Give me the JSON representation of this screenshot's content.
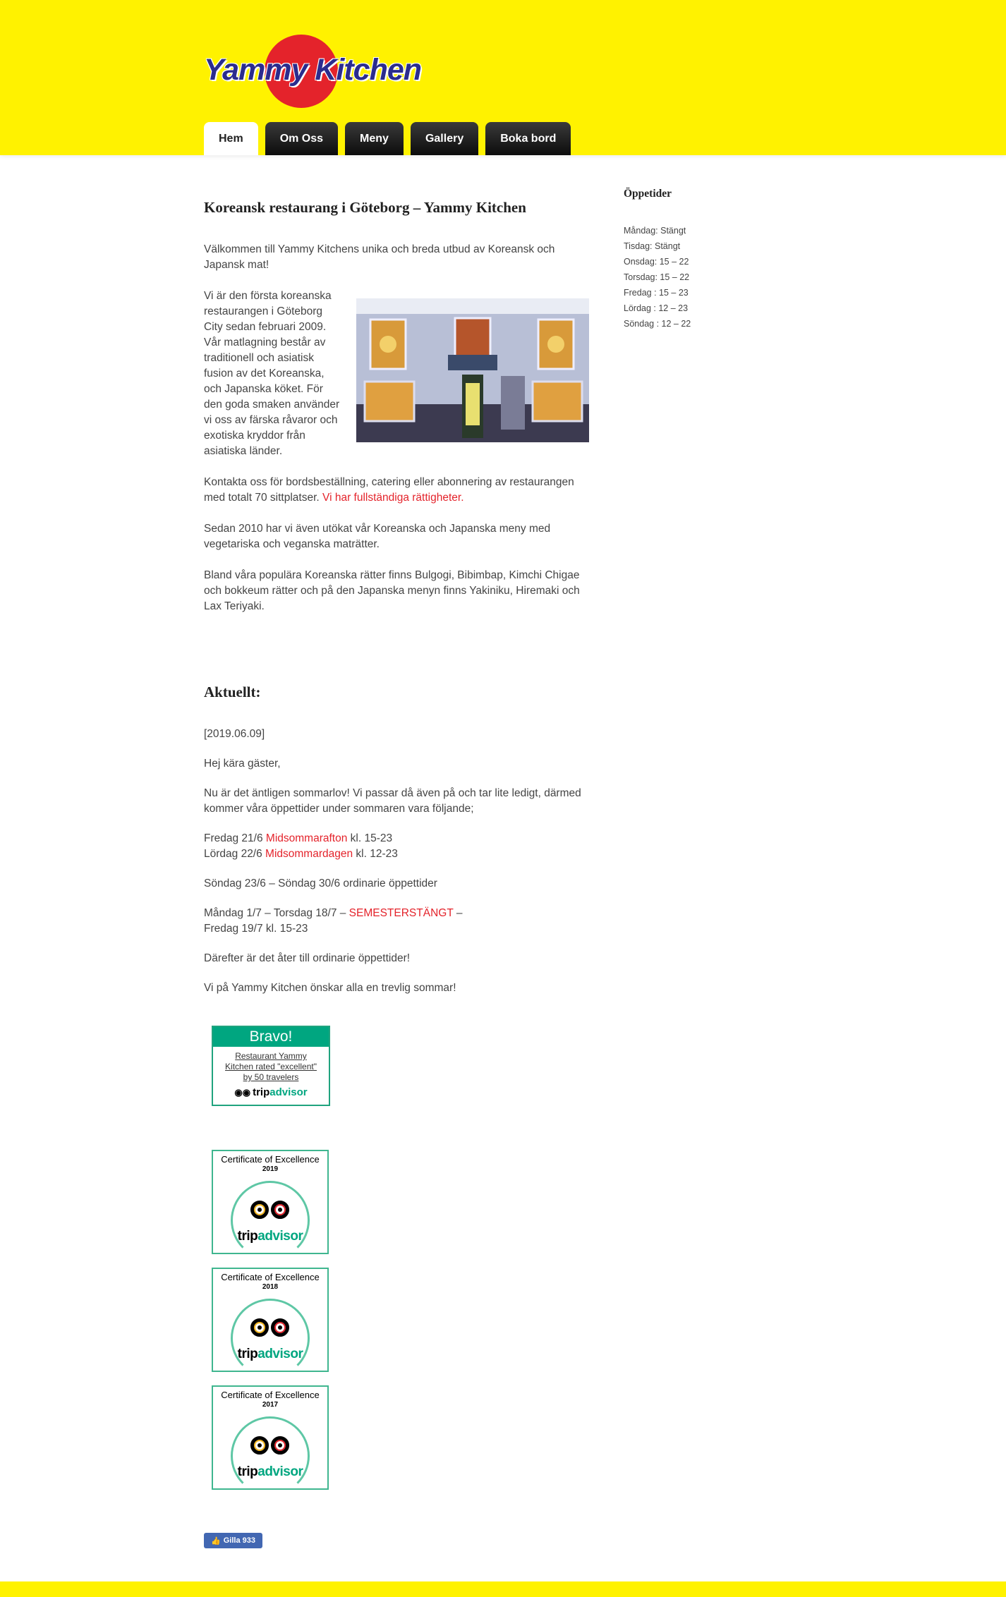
{
  "brand": {
    "name": "Yammy Kitchen",
    "color_primary": "#fff200",
    "color_accent": "#e4232b",
    "logo_text_color": "#2b2c8e"
  },
  "nav": [
    {
      "label": "Hem",
      "active": true
    },
    {
      "label": "Om Oss",
      "active": false
    },
    {
      "label": "Meny",
      "active": false
    },
    {
      "label": "Gallery",
      "active": false
    },
    {
      "label": "Boka bord",
      "active": false
    }
  ],
  "main": {
    "title": "Koreansk restaurang i Göteborg – Yammy Kitchen",
    "intro": "Välkommen till Yammy Kitchens unika och breda utbud av Koreansk och Japansk mat!",
    "about": "Vi är den första koreanska restaurangen i Göteborg City sedan februari 2009. Vår matlagning består av traditionell och asiatisk fusion av det Koreanska, och Japanska köket. För den goda smaken använder vi oss av färska råvaror och exotiska kryddor från asiatiska länder.",
    "contact": "Kontakta oss för bordsbeställning, catering eller abonnering av restaurangen med totalt 70 sittplatser.",
    "contact_link": "Vi har fullständiga rättigheter.",
    "vegan": "Sedan 2010 har vi även utökat vår Koreanska och Japanska meny med vegetariska och veganska maträtter.",
    "popular": "Bland våra populära Koreanska rätter finns Bulgogi, Bibimbap, Kimchi Chigae och bokkeum rätter och på den Japanska menyn finns Yakiniku, Hiremaki och Lax Teriyaki."
  },
  "news": {
    "heading": "Aktuellt:",
    "date": "[2019.06.09]",
    "greeting": "Hej kära gäster,",
    "summer": "Nu är det äntligen sommarlov! Vi passar då även på och tar lite ledigt, därmed kommer våra öppettider under sommaren vara följande;",
    "fri_prefix": "Fredag 21/6 ",
    "fri_link": "Midsommarafton",
    "fri_suffix": " kl. 15-23",
    "sat_prefix": "Lördag 22/6 ",
    "sat_link": "Midsommardagen",
    "sat_suffix": " kl. 12-23",
    "sun_line": "Söndag 23/6 – Söndag 30/6 ordinarie öppettider",
    "closed_prefix": "Måndag 1/7 – Torsdag 18/7 – ",
    "closed_link": "SEMESTERSTÄNGT",
    "closed_suffix": " –",
    "reopen": "Fredag 19/7 kl. 15-23",
    "after": "Därefter är det åter till ordinarie öppettider!",
    "wish": "Vi på Yammy Kitchen önskar alla en trevlig sommar!"
  },
  "sidebar": {
    "heading": "Öppetider",
    "hours": [
      "Måndag: Stängt",
      "Tisdag: Stängt",
      "Onsdag: 15 – 22",
      "Torsdag: 15 – 22",
      "Fredag : 15 – 23",
      "Lördag : 12 – 23",
      "Söndag : 12 – 22"
    ]
  },
  "tripadvisor": {
    "bravo_heading": "Bravo!",
    "bravo_text": "Restaurant Yammy Kitchen rated \"excellent\" by 50 travelers",
    "brand_prefix": "trip",
    "brand_suffix": "advisor",
    "certificates": [
      {
        "title": "Certificate of Excellence",
        "year": "2019"
      },
      {
        "title": "Certificate of Excellence",
        "year": "2018"
      },
      {
        "title": "Certificate of Excellence",
        "year": "2017"
      }
    ]
  },
  "facebook": {
    "like_label": "Gilla 933"
  }
}
